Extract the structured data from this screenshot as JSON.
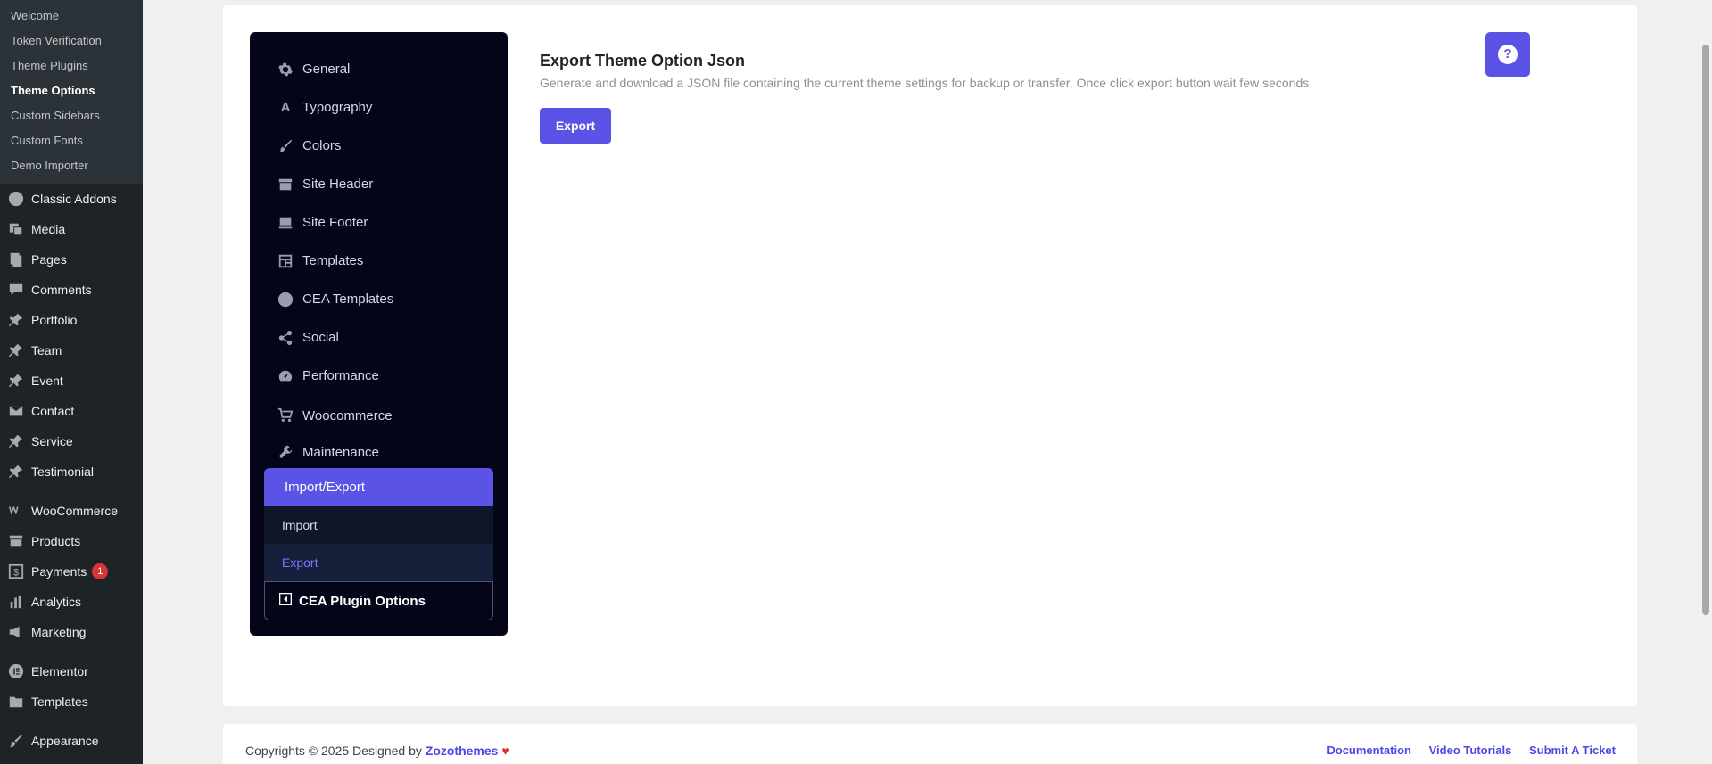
{
  "wp_sidebar": {
    "submenu": [
      {
        "label": "Welcome"
      },
      {
        "label": "Token Verification"
      },
      {
        "label": "Theme Plugins"
      },
      {
        "label": "Theme Options",
        "active": true
      },
      {
        "label": "Custom Sidebars"
      },
      {
        "label": "Custom Fonts"
      },
      {
        "label": "Demo Importer"
      }
    ],
    "menu": [
      {
        "label": "Classic Addons",
        "icon": "addons-icon"
      },
      {
        "label": "Media",
        "icon": "media-icon"
      },
      {
        "label": "Pages",
        "icon": "pages-icon"
      },
      {
        "label": "Comments",
        "icon": "comments-icon"
      },
      {
        "label": "Portfolio",
        "icon": "pin-icon"
      },
      {
        "label": "Team",
        "icon": "pin-icon"
      },
      {
        "label": "Event",
        "icon": "pin-icon"
      },
      {
        "label": "Contact",
        "icon": "mail-icon"
      },
      {
        "label": "Service",
        "icon": "pin-icon"
      },
      {
        "label": "Testimonial",
        "icon": "pin-icon"
      },
      {
        "label": "WooCommerce",
        "icon": "woocommerce-icon"
      },
      {
        "label": "Products",
        "icon": "archive-icon"
      },
      {
        "label": "Payments",
        "icon": "dollar-icon",
        "badge": "1"
      },
      {
        "label": "Analytics",
        "icon": "bar-chart-icon"
      },
      {
        "label": "Marketing",
        "icon": "megaphone-icon"
      },
      {
        "label": "Elementor",
        "icon": "elementor-icon"
      },
      {
        "label": "Templates",
        "icon": "folder-icon"
      },
      {
        "label": "Appearance",
        "icon": "brush-icon"
      }
    ]
  },
  "options_nav": {
    "items": [
      {
        "label": "General",
        "icon": "gear-icon"
      },
      {
        "label": "Typography",
        "icon": "typography-icon",
        "letter": "A"
      },
      {
        "label": "Colors",
        "icon": "brush-icon"
      },
      {
        "label": "Site Header",
        "icon": "header-icon"
      },
      {
        "label": "Site Footer",
        "icon": "footer-icon"
      },
      {
        "label": "Templates",
        "icon": "templates-icon"
      },
      {
        "label": "CEA Templates",
        "icon": "cea-icon"
      },
      {
        "label": "Social",
        "icon": "share-icon"
      },
      {
        "label": "Performance",
        "icon": "dashboard-icon"
      },
      {
        "label": "Woocommerce",
        "icon": "cart-icon"
      },
      {
        "label": "Maintenance",
        "icon": "wrench-icon"
      }
    ],
    "active": {
      "label": "Import/Export",
      "icon": "import-export-icon"
    },
    "subitems": [
      {
        "label": "Import"
      },
      {
        "label": "Export",
        "current": true
      }
    ],
    "plugin": {
      "label": "CEA Plugin Options",
      "icon": "plugin-options-icon"
    }
  },
  "content": {
    "title": "Export Theme Option Json",
    "description": "Generate and download a JSON file containing the current theme settings for backup or transfer. Once click export button wait few seconds.",
    "export_label": "Export",
    "help_symbol": "?"
  },
  "footer": {
    "copyright_prefix": "Copyrights © 2025 Designed by",
    "brand": "Zozothemes",
    "heart": "♥",
    "links": [
      "Documentation",
      "Video Tutorials",
      "Submit A Ticket"
    ]
  },
  "colors": {
    "accent": "#5b53e6",
    "nav_bg": "#05051a",
    "wp_sidebar_bg": "#1d2327"
  }
}
